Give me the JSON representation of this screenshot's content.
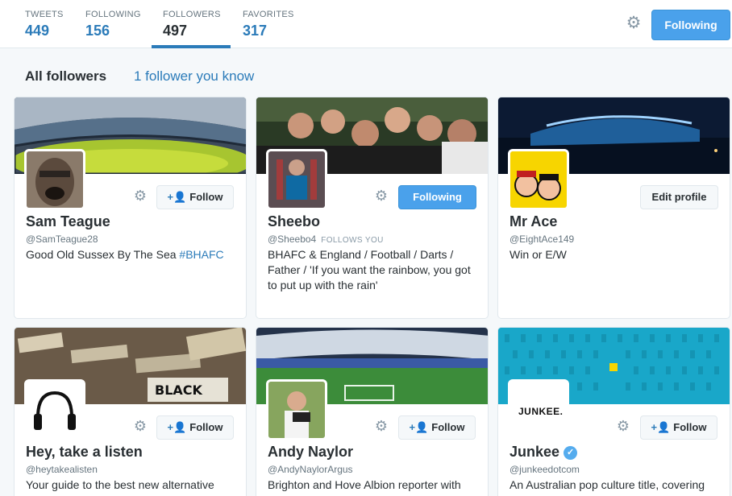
{
  "nav": {
    "stats": [
      {
        "label": "TWEETS",
        "value": "449"
      },
      {
        "label": "FOLLOWING",
        "value": "156"
      },
      {
        "label": "FOLLOWERS",
        "value": "497"
      },
      {
        "label": "FAVORITES",
        "value": "317"
      }
    ],
    "active_stat": "FOLLOWERS",
    "settings_icon": "gear-icon",
    "following_label": "Following"
  },
  "section": {
    "title": "All followers",
    "link": "1 follower you know"
  },
  "cards": [
    {
      "name": "Sam Teague",
      "handle": "@SamTeague28",
      "bio": "Good Old Sussex By The Sea ",
      "bio_tag": "#BHAFC",
      "button": "Follow"
    },
    {
      "name": "Sheebo",
      "handle": "@Sheebo4",
      "follows_you": "FOLLOWS YOU",
      "bio": "BHAFC & England / Football / Darts / Father / 'If you want the rainbow, you got to put up with the rain'",
      "button": "Following"
    },
    {
      "name": "Mr Ace",
      "handle": "@EightAce149",
      "bio": "Win or E/W",
      "button": "Edit profile"
    },
    {
      "name": "Hey, take a listen",
      "handle": "@heytakealisten",
      "bio": "Your guide to the best new alternative",
      "button": "Follow",
      "banner_text": "BLACK"
    },
    {
      "name": "Andy Naylor",
      "handle": "@AndyNaylorArgus",
      "bio": "Brighton and Hove Albion reporter with",
      "button": "Follow"
    },
    {
      "name": "Junkee",
      "handle": "@junkeedotcom",
      "bio": "An Australian pop culture title, covering",
      "button": "Follow",
      "avatar_text": "JUNKEE.",
      "verified_icon": "verified-badge-icon"
    }
  ],
  "colors": {
    "accent": "#2b7bb9",
    "button_blue": "#4aa1eb",
    "junkee_blue": "#19a7c9"
  }
}
